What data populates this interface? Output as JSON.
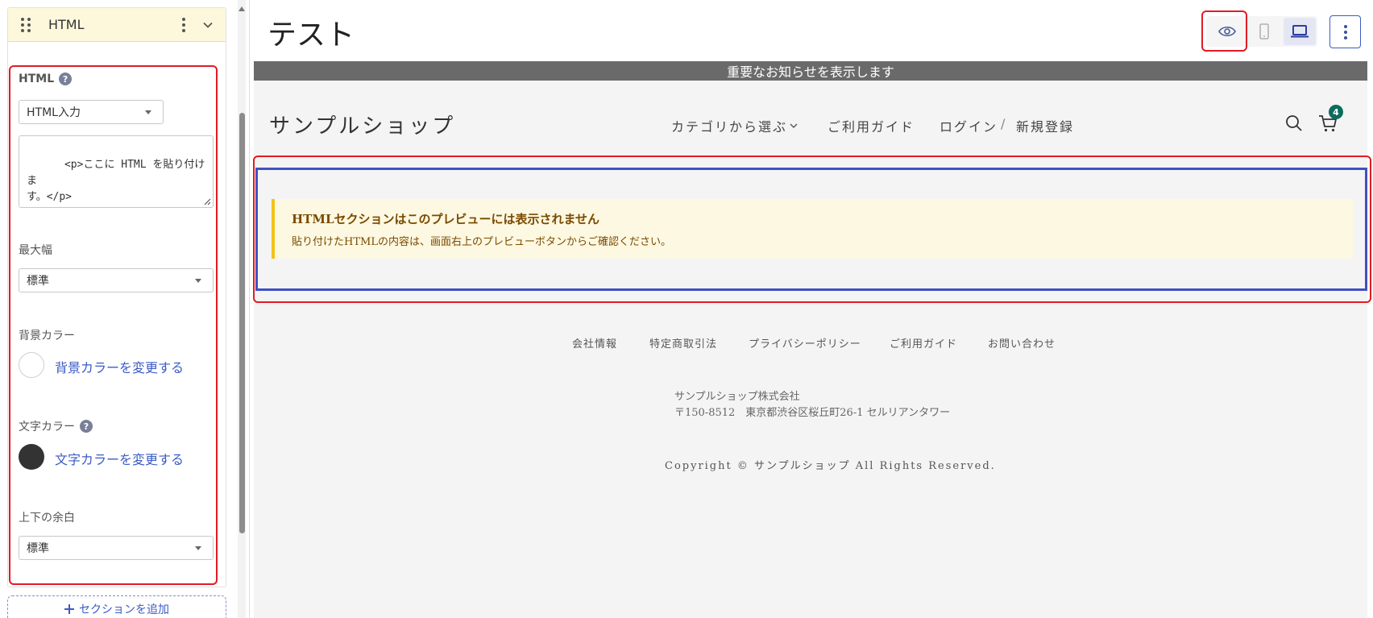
{
  "sidebar": {
    "panel_title": "HTML",
    "html_label": "HTML",
    "html_input_mode": "HTML入力",
    "html_code": "<p>ここに HTML を貼り付けま\nす。</p>",
    "max_width_label": "最大幅",
    "max_width_value": "標準",
    "bg_color_label": "背景カラー",
    "bg_color_link": "背景カラーを変更する",
    "bg_color_value": "#ffffff",
    "text_color_label": "文字カラー",
    "text_color_link": "文字カラーを変更する",
    "text_color_value": "#333333",
    "padding_label": "上下の余白",
    "padding_value": "標準",
    "add_section": "セクションを追加"
  },
  "header": {
    "title": "テスト"
  },
  "preview": {
    "announcement": "重要なお知らせを表示します",
    "shop_name": "サンプルショップ",
    "nav": {
      "category": "カテゴリから選ぶ",
      "guide": "ご利用ガイド",
      "login": "ログイン",
      "separator": "/",
      "register": "新規登録"
    },
    "cart_count": "4",
    "notice_title": "HTMLセクションはこのプレビューには表示されません",
    "notice_body": "貼り付けたHTMLの内容は、画面右上のプレビューボタンからご確認ください。",
    "footer_links": [
      "会社情報",
      "特定商取引法",
      "プライバシーポリシー",
      "ご利用ガイド",
      "お問い合わせ"
    ],
    "company_name": "サンプルショップ株式会社",
    "company_address": "〒150-8512　東京都渋谷区桜丘町26-1 セルリアンタワー",
    "copyright": "Copyright © サンプルショップ All Rights Reserved."
  }
}
